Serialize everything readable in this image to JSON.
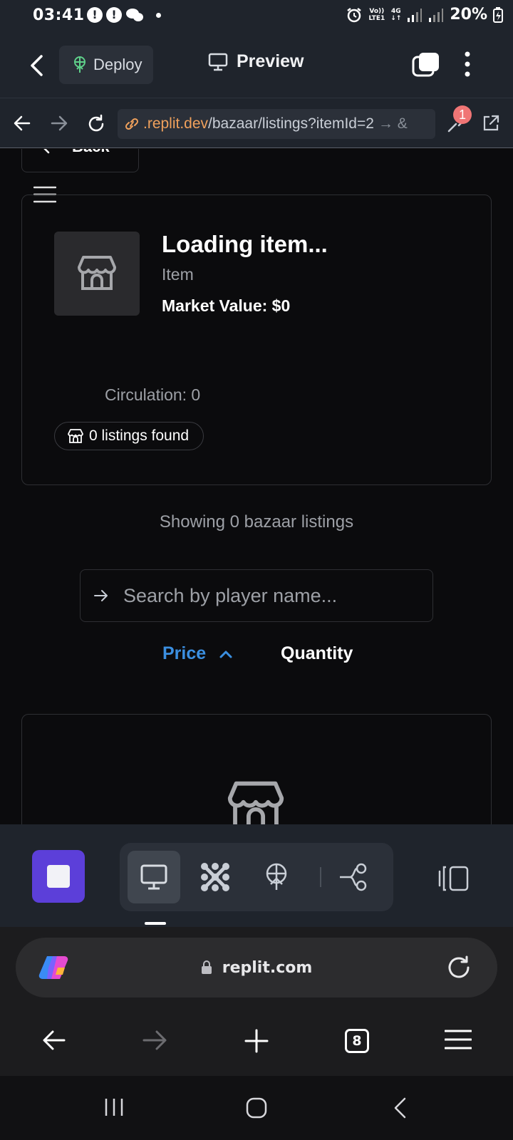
{
  "status": {
    "time": "03:41",
    "network_top": "Vo))",
    "network_bottom": "LTE1",
    "network_type": "4G",
    "battery": "20%"
  },
  "topbar": {
    "deploy_label": "Deploy",
    "preview_label": "Preview"
  },
  "preview_nav": {
    "url_domain": ".replit.dev",
    "url_path": "/bazaar/listings?itemId=2",
    "url_more": "→ &",
    "devtools_badge": "1"
  },
  "page": {
    "back_label": "Back",
    "item": {
      "title": "Loading item...",
      "type": "Item",
      "market_value": "Market Value: $0",
      "circulation": "Circulation: 0",
      "listings_found": "0 listings found"
    },
    "showing": "Showing 0 bazaar listings",
    "search_placeholder": "Search by player name...",
    "sort": {
      "price_label": "Price",
      "quantity_label": "Quantity",
      "active": "price",
      "direction": "asc"
    }
  },
  "browser": {
    "address": "replit.com",
    "tab_count": "8"
  },
  "colors": {
    "accent_blue": "#3b8fe0",
    "stop_purple": "#5c3fd9",
    "url_orange": "#f0a15c",
    "badge_red": "#f07575"
  }
}
